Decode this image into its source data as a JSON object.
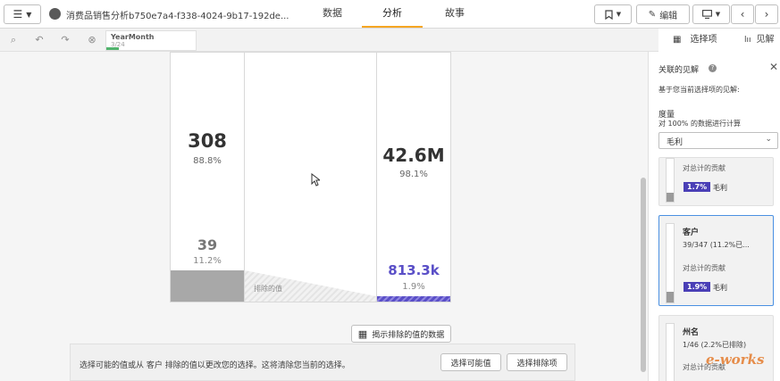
{
  "header": {
    "app_title": "消费品销售分析b750e7a4-f338-4024-9b17-192de...",
    "tabs": [
      {
        "label": "数据"
      },
      {
        "label": "分析",
        "active": true
      },
      {
        "label": "故事"
      }
    ],
    "edit_label": "编辑"
  },
  "selection": {
    "field": "YearMonth",
    "count": "3/24"
  },
  "right_tabs": {
    "selections": "选择项",
    "insights": "见解"
  },
  "main": {
    "col1": {
      "value": "308",
      "pct": "88.8%",
      "excluded_value": "39",
      "excluded_pct": "11.2%"
    },
    "col3": {
      "value": "42.6M",
      "pct": "98.1%",
      "excluded_value": "813.3k",
      "excluded_pct": "1.9%"
    },
    "excluded_label": "排除的值",
    "show_excluded_button": "揭示排除的值的数据",
    "notice_text": "选择可能的值或从 客户 排除的值以更改您的选择。这将清除您当前的选择。",
    "select_possible_button": "选择可能值",
    "select_excluded_button": "选择排除项",
    "accent_color": "#5a4fc7"
  },
  "panel": {
    "title": "关联的见解",
    "subtitle": "基于您当前选择项的见解:",
    "measure_heading": "度量",
    "calc_note": "对 100% 的数据进行计算",
    "measure_select": "毛利",
    "cards": [
      {
        "name": "",
        "count": "",
        "contrib_label": "对总计的贡献",
        "badge": "1.7%",
        "measure": "毛利"
      },
      {
        "name": "客户",
        "count": "39/347 (11.2%已...",
        "contrib_label": "对总计的贡献",
        "badge": "1.9%",
        "measure": "毛利"
      },
      {
        "name": "州名",
        "count": "1/46 (2.2%已排除)",
        "contrib_label": "对总计的贡献"
      }
    ]
  },
  "watermark": "e-works"
}
